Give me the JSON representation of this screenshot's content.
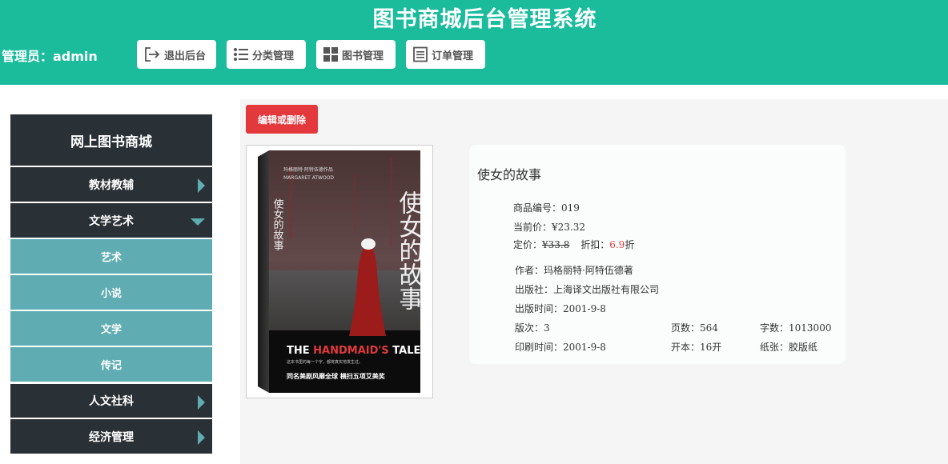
{
  "header": {
    "title": "图书商城后台管理系统",
    "admin": "管理员：admin",
    "buttons": [
      {
        "label": "退出后台",
        "icon": "logout-icon"
      },
      {
        "label": "分类管理",
        "icon": "list-icon"
      },
      {
        "label": "图书管理",
        "icon": "grid-icon"
      },
      {
        "label": "订单管理",
        "icon": "document-icon"
      }
    ]
  },
  "sidebar": {
    "title": "网上图书商城",
    "categories": [
      {
        "label": "教材教辅",
        "expanded": false
      },
      {
        "label": "文学艺术",
        "expanded": true,
        "children": [
          "艺术",
          "小说",
          "文学",
          "传记"
        ]
      },
      {
        "label": "人文社科",
        "expanded": false
      },
      {
        "label": "经济管理",
        "expanded": false
      }
    ]
  },
  "main": {
    "edit_button": "编辑或删除",
    "cover": {
      "title": "使女的故事",
      "author_line": "玛格丽特·阿特伍德作品",
      "author_en": "MARGARET ATWOOD",
      "en_title_a": "THE ",
      "en_title_b": "HANDMAID'S",
      "en_title_c": " TALE",
      "blurb": "这本书里的每一个字，都将真实地发生过。",
      "slogan": "同名美剧风靡全球   横扫五项艾美奖"
    },
    "book": {
      "name": "使女的故事",
      "id_label": "商品编号：",
      "id": "019",
      "current_price_label": "当前价：",
      "current_price": "¥23.32",
      "list_price_label": "定价：",
      "list_price": "¥33.8",
      "discount_label": "折扣：",
      "discount": "6.9",
      "discount_suffix": "折",
      "author_label": "作者：",
      "author": "玛格丽特·阿特伍德著",
      "publisher_label": "出版社：",
      "publisher": "上海译文出版社有限公司",
      "pub_date_label": "出版时间：",
      "pub_date": "2001-9-8",
      "edition_label": "版次：",
      "edition": "3",
      "pages_label": "页数：",
      "pages": "564",
      "words_label": "字数：",
      "words": "1013000",
      "print_date_label": "印刷时间：",
      "print_date": "2001-9-8",
      "format_label": "开本：",
      "format": "16开",
      "paper_label": "纸张：",
      "paper": "胶版纸"
    }
  },
  "colors": {
    "header_bg": "#1abc9c",
    "sidebar_dark": "#2a3136",
    "sidebar_sub": "#5fadb2",
    "danger": "#e3393c"
  }
}
